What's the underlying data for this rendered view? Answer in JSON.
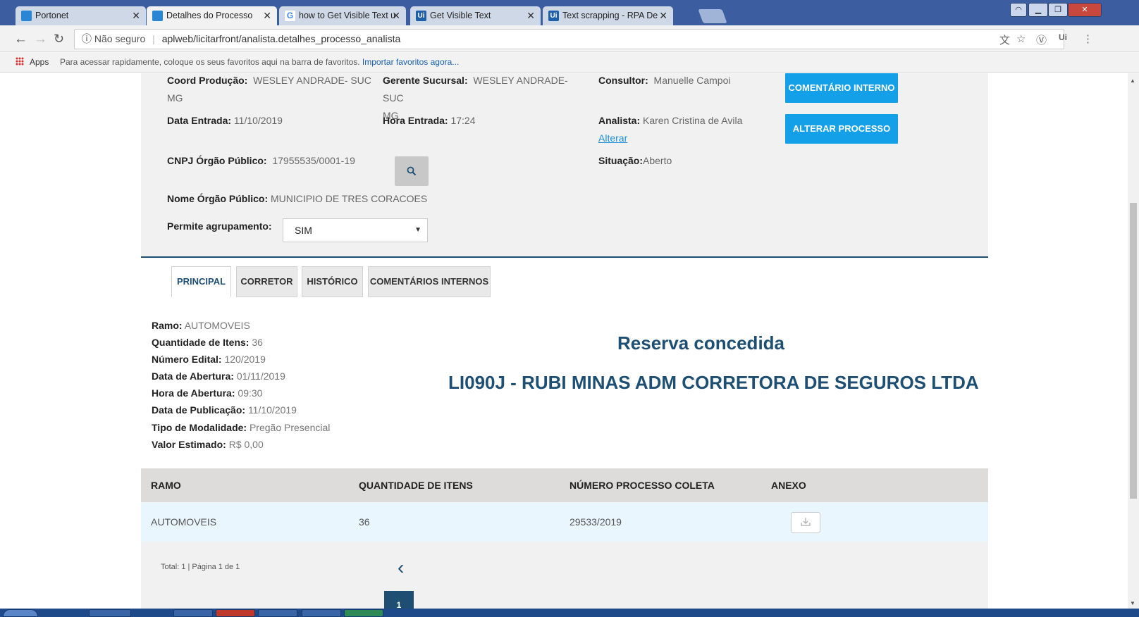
{
  "browser": {
    "tabs": [
      {
        "title": "Portonet",
        "icon": "portonet-icon",
        "active": false
      },
      {
        "title": "Detalhes do Processo",
        "icon": "portonet-icon",
        "active": true
      },
      {
        "title": "how to Get Visible Text u",
        "icon": "google-icon",
        "active": false
      },
      {
        "title": "Get Visible Text",
        "icon": "uipath-icon",
        "active": false
      },
      {
        "title": "Text scrapping - RPA De",
        "icon": "uipath-icon",
        "active": false
      }
    ],
    "security_label": "Não seguro",
    "url": "aplweb/licitarfront/analista.detalhes_processo_analista",
    "bookmarks_apps": "Apps",
    "bookmarks_hint": "Para acessar rapidamente, coloque os seus favoritos aqui na barra de favoritos.",
    "bookmarks_import": "Importar favoritos agora..."
  },
  "header": {
    "coord_label": "Coord Produção:",
    "coord_value": "WESLEY ANDRADE- SUC",
    "coord_value2": "MG",
    "gerente_label": "Gerente Sucursal:",
    "gerente_value": "WESLEY ANDRADE- SUC",
    "gerente_value2": "MG",
    "consultor_label": "Consultor:",
    "consultor_value": "Manuelle Campoi",
    "data_entrada_label": "Data Entrada:",
    "data_entrada_value": "11/10/2019",
    "hora_entrada_label": "Hora Entrada:",
    "hora_entrada_value": "17:24",
    "analista_label": "Analista:",
    "analista_value": "Karen Cristina de Avila",
    "alterar_link": "Alterar",
    "cnpj_label": "CNPJ Órgão Público:",
    "cnpj_value": "17955535/0001-19",
    "situacao_label": "Situação:",
    "situacao_value": "Aberto",
    "nome_orgao_label": "Nome Órgão Público:",
    "nome_orgao_value": "MUNICIPIO DE TRES CORACOES",
    "agrupamento_label": "Permite agrupamento:",
    "agrupamento_value": "SIM",
    "comentario_btn": "COMENTÁRIO INTERNO",
    "alterar_btn": "ALTERAR PROCESSO"
  },
  "tabs": [
    {
      "label": "PRINCIPAL",
      "active": true
    },
    {
      "label": "CORRETOR",
      "active": false
    },
    {
      "label": "HISTÓRICO",
      "active": false
    },
    {
      "label": "COMENTÁRIOS INTERNOS",
      "active": false
    }
  ],
  "details": [
    {
      "label": "Ramo:",
      "value": "AUTOMOVEIS"
    },
    {
      "label": "Quantidade de Itens:",
      "value": "36"
    },
    {
      "label": "Número Edital:",
      "value": "120/2019"
    },
    {
      "label": "Data de Abertura:",
      "value": "01/11/2019"
    },
    {
      "label": "Hora de Abertura:",
      "value": "09:30"
    },
    {
      "label": "Data de Publicação:",
      "value": "11/10/2019"
    },
    {
      "label": "Tipo de Modalidade:",
      "value": "Pregão Presencial"
    },
    {
      "label": "Valor Estimado:",
      "value": "R$ 0,00"
    }
  ],
  "status_title": "Reserva concedida",
  "status_corretora": "LI090J - RUBI MINAS ADM CORRETORA DE SEGUROS LTDA",
  "table": {
    "headers": [
      "RAMO",
      "QUANTIDADE DE ITENS",
      "NÚMERO PROCESSO COLETA",
      "ANEXO"
    ],
    "rows": [
      {
        "ramo": "AUTOMOVEIS",
        "quantidade": "36",
        "numero": "29533/2019",
        "anexo_icon": "download-icon"
      }
    ]
  },
  "pager": {
    "info": "Total: 1 | Página 1 de 1",
    "current_page": "1"
  },
  "colors": {
    "accent_blue": "#13a0e8",
    "navy": "#1e4f73",
    "tab_strip": "#3c5ea0"
  }
}
